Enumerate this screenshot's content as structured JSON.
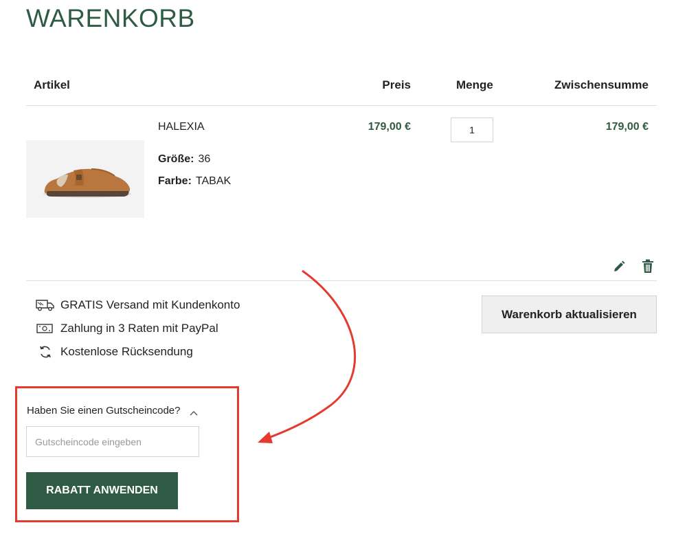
{
  "page": {
    "title": "WARENKORB"
  },
  "cart": {
    "columns": {
      "item": "Artikel",
      "price": "Preis",
      "quantity": "Menge",
      "subtotal": "Zwischensumme"
    },
    "items": [
      {
        "name": "HALEXIA",
        "attributes": [
          {
            "label": "Größe:",
            "value": "36"
          },
          {
            "label": "Farbe:",
            "value": "TABAK"
          }
        ],
        "price": "179,00 €",
        "quantity": "1",
        "subtotal": "179,00 €"
      }
    ],
    "update_label": "Warenkorb aktualisieren"
  },
  "benefits": [
    {
      "icon": "truck-icon",
      "text": "GRATIS Versand mit Kundenkonto"
    },
    {
      "icon": "banknote-icon",
      "text": "Zahlung in 3 Raten mit PayPal"
    },
    {
      "icon": "refresh-icon",
      "text": "Kostenlose Rücksendung"
    }
  ],
  "coupon": {
    "question": "Haben Sie einen Gutscheincode?",
    "placeholder": "Gutscheincode eingeben",
    "apply_label": "RABATT ANWENDEN"
  },
  "colors": {
    "brand": "#2f5b45",
    "annotation": "#e53a2f"
  }
}
